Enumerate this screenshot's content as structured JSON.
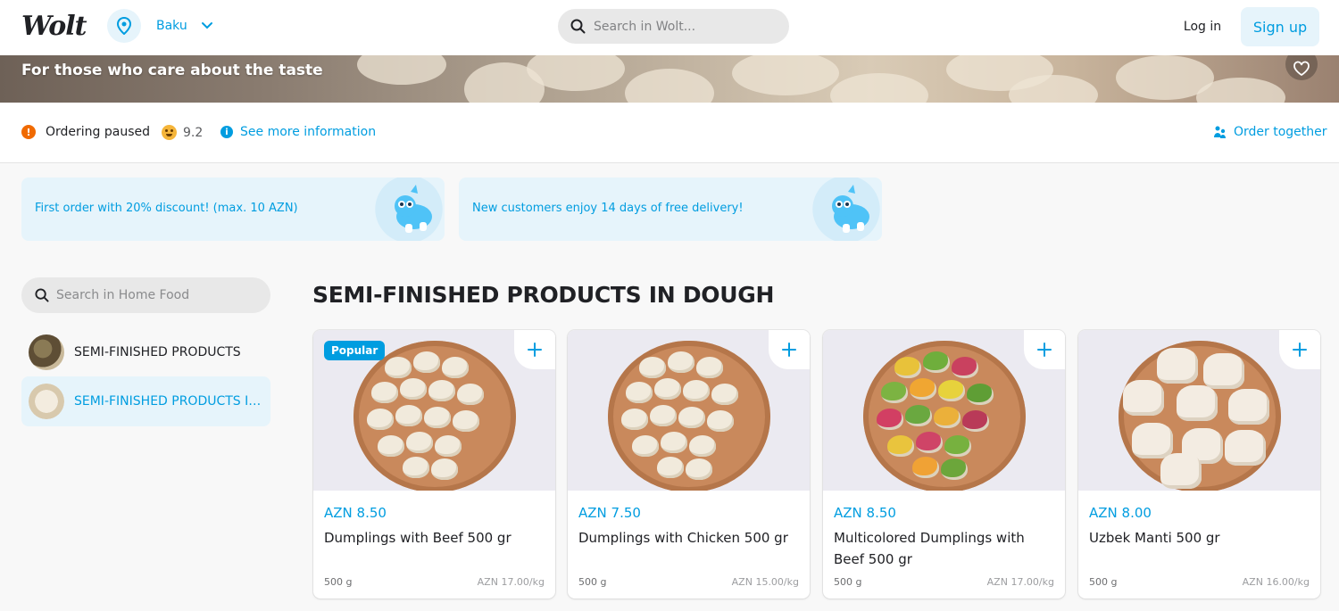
{
  "header": {
    "logo": "Wolt",
    "city": "Baku",
    "search_placeholder": "Search in Wolt...",
    "login_label": "Log in",
    "signup_label": "Sign up"
  },
  "hero": {
    "tagline": "For those who care about the taste"
  },
  "info": {
    "status": "Ordering paused",
    "rating": "9.2",
    "more_info": "See more information",
    "order_together": "Order together"
  },
  "promos": [
    {
      "text": "First order with 20% discount! (max. 10 AZN)"
    },
    {
      "text": "New customers enjoy 14 days of free delivery!"
    }
  ],
  "sidebar": {
    "search_placeholder": "Search in Home Food",
    "categories": [
      {
        "label": "SEMI-FINISHED PRODUCTS"
      },
      {
        "label": "SEMI-FINISHED PRODUCTS IN DOUGH"
      }
    ]
  },
  "section": {
    "title": "SEMI-FINISHED PRODUCTS IN DOUGH"
  },
  "products": [
    {
      "badge": "Popular",
      "price": "AZN 8.50",
      "name": "Dumplings with Beef 500 gr",
      "weight": "500 g",
      "unit_price": "AZN 17.00/kg"
    },
    {
      "price": "AZN 7.50",
      "name": "Dumplings with Chicken 500 gr",
      "weight": "500 g",
      "unit_price": "AZN 15.00/kg"
    },
    {
      "price": "AZN 8.50",
      "name": "Multicolored Dumplings with Beef 500 gr",
      "weight": "500 g",
      "unit_price": "AZN 17.00/kg"
    },
    {
      "price": "AZN 8.00",
      "name": "Uzbek Manti 500 gr",
      "weight": "500 g",
      "unit_price": "AZN 16.00/kg"
    }
  ],
  "colors": {
    "accent": "#009de0",
    "accent_bg": "#e6f4fb",
    "paused": "#f06a00"
  }
}
